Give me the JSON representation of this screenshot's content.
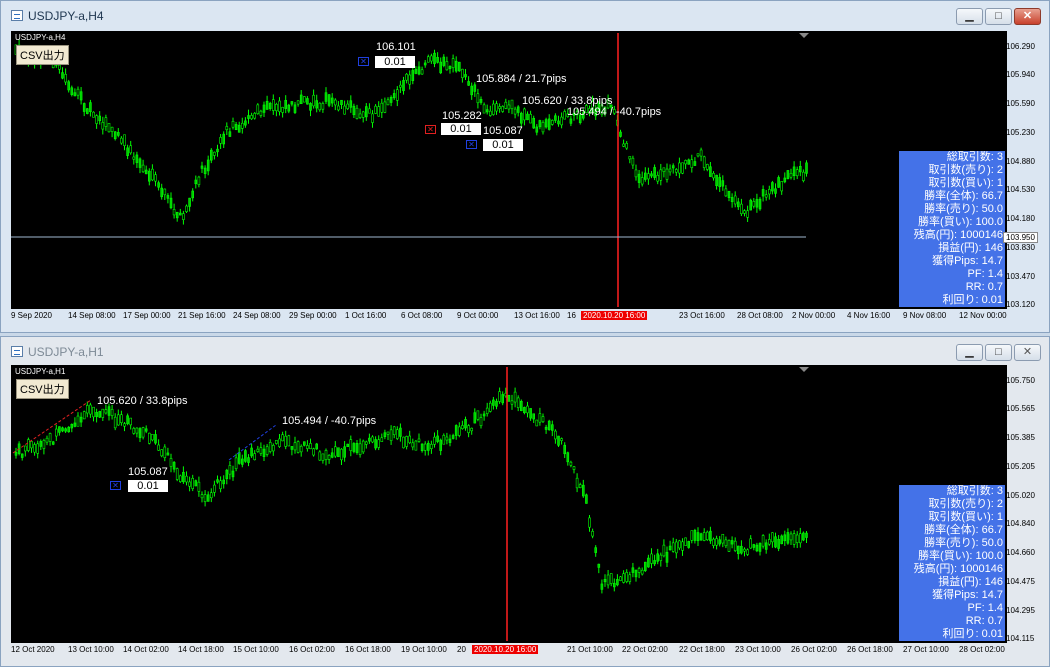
{
  "top_window": {
    "title": "USDJPY-a,H4",
    "chart_label": "USDJPY-a,H4",
    "csv_button": "CSV出力",
    "price_axis": [
      "106.290",
      "105.940",
      "105.590",
      "105.230",
      "104.880",
      "104.530",
      "104.180",
      "103.830",
      "103.470",
      "103.120"
    ],
    "current_price": "103.950",
    "time_axis": [
      "9 Sep 2020",
      "14 Sep 08:00",
      "17 Sep 00:00",
      "21 Sep 16:00",
      "24 Sep 08:00",
      "29 Sep 00:00",
      "1 Oct 16:00",
      "6 Oct 08:00",
      "9 Oct 00:00",
      "13 Oct 16:00",
      "16",
      "2020.10.20 16:00",
      "23 Oct 16:00",
      "28 Oct 08:00",
      "2 Nov 00:00",
      "4 Nov 16:00",
      "9 Nov 08:00",
      "12 Nov 00:00"
    ],
    "annotations": [
      {
        "price": "106.101",
        "lot": "0.01"
      },
      {
        "text": "105.884 / 21.7pips"
      },
      {
        "text": "105.620 / 33.8pips"
      },
      {
        "price": "105.282",
        "lot": "0.01"
      },
      {
        "text": "105.494 / -40.7pips"
      },
      {
        "price": "105.087",
        "lot": "0.01"
      }
    ]
  },
  "bottom_window": {
    "title": "USDJPY-a,H1",
    "chart_label": "USDJPY-a,H1",
    "csv_button": "CSV出力",
    "price_axis": [
      "105.750",
      "105.565",
      "105.385",
      "105.205",
      "105.020",
      "104.840",
      "104.660",
      "104.475",
      "104.295",
      "104.115"
    ],
    "time_axis": [
      "12 Oct 2020",
      "13 Oct 10:00",
      "14 Oct 02:00",
      "14 Oct 18:00",
      "15 Oct 10:00",
      "16 Oct 02:00",
      "16 Oct 18:00",
      "19 Oct 10:00",
      "20",
      "2020.10.20 16:00",
      "21 Oct 10:00",
      "22 Oct 02:00",
      "22 Oct 18:00",
      "23 Oct 10:00",
      "26 Oct 02:00",
      "26 Oct 18:00",
      "27 Oct 10:00",
      "28 Oct 02:00"
    ],
    "annotations": [
      {
        "text": "105.620 / 33.8pips"
      },
      {
        "text": "105.494 / -40.7pips"
      },
      {
        "price": "105.087",
        "lot": "0.01"
      }
    ]
  },
  "stats_panel": [
    "総取引数: 3",
    "取引数(売り): 2",
    "取引数(買い): 1",
    "勝率(全体): 66.7",
    "勝率(売り): 50.0",
    "勝率(買い): 100.0",
    "残高(円): 1000146",
    "損益(円): 146",
    "獲得Pips: 14.7",
    "PF: 1.4",
    "RR: 0.7",
    "利回り: 0.01"
  ],
  "colors": {
    "bull": "#00ff00",
    "bear": "#00cc00",
    "vline": "#ff2020",
    "panel": "#4472e8",
    "sell": "#e02020",
    "buy": "#2040e0"
  },
  "window_buttons": {
    "minimize": "▁",
    "maximize": "□",
    "close": "✕"
  }
}
